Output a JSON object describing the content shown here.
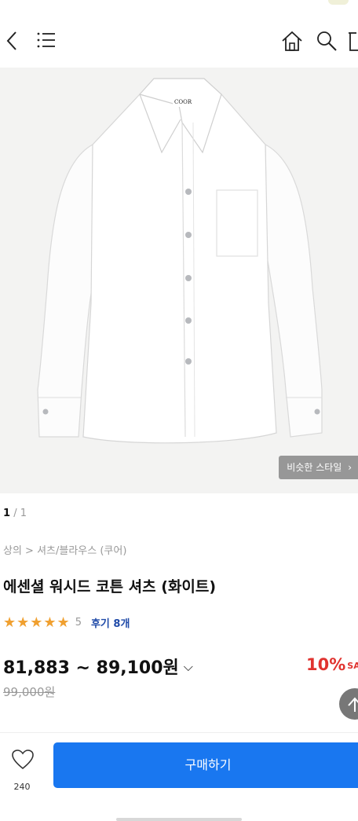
{
  "header": {
    "back_icon": "back-chevron-icon",
    "menu_icon": "hamburger-menu-icon",
    "home_icon": "home-icon",
    "search_icon": "search-icon",
    "cart_icon": "cart-icon"
  },
  "gallery": {
    "image_logo": "COOR",
    "similar_style_label": "비슷한 스타일",
    "current_page": "1",
    "total_pages": "/ 1"
  },
  "product": {
    "breadcrumb": "상의 > 셔츠/블라우스 (쿠어)",
    "title": "에센셜 워시드 코튼 셔츠 (화이트)",
    "stars": "★★★★★",
    "rating_count": "5",
    "review_link": "후기 8개",
    "price_range": "81,883 ~ 89,100원",
    "discount": "10%",
    "discount_suffix": "SA",
    "original_price": "99,000원"
  },
  "bottom_bar": {
    "like_count": "240",
    "buy_label": "구매하기"
  },
  "colors": {
    "accent_blue": "#1977f0",
    "discount_red": "#e0332f",
    "star_orange": "#f0a030",
    "review_link_blue": "#1f4aa8"
  }
}
